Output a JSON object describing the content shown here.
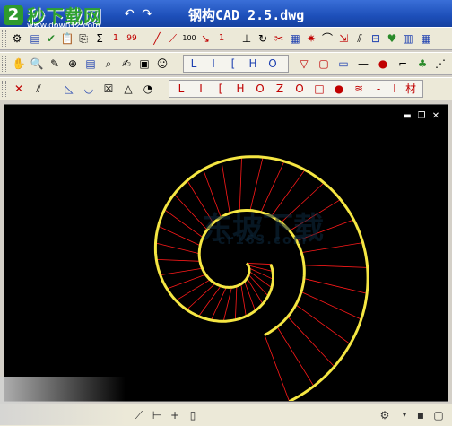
{
  "window": {
    "title": "钢构CAD  2.5.dwg",
    "logo_number": "2",
    "logo_brand": "秒下载网",
    "logo_url": "www.down12.com"
  },
  "toolbar1": {
    "numbers": [
      "1",
      "99",
      "100",
      "1"
    ]
  },
  "toolbar2": {
    "letter_group": [
      "L",
      "I",
      "[",
      "H",
      "O"
    ]
  },
  "toolbar3": {
    "shape_group": [
      "L",
      "I",
      "[",
      "H",
      "O",
      "Z",
      "O",
      "□",
      "●",
      "≋",
      "-",
      "I",
      "材"
    ]
  },
  "canvas": {
    "watermark": "东坡下载",
    "watermark_sub": "cr163.com",
    "spiral_color": "#f5e642",
    "ray_color": "#ff1a1a"
  }
}
